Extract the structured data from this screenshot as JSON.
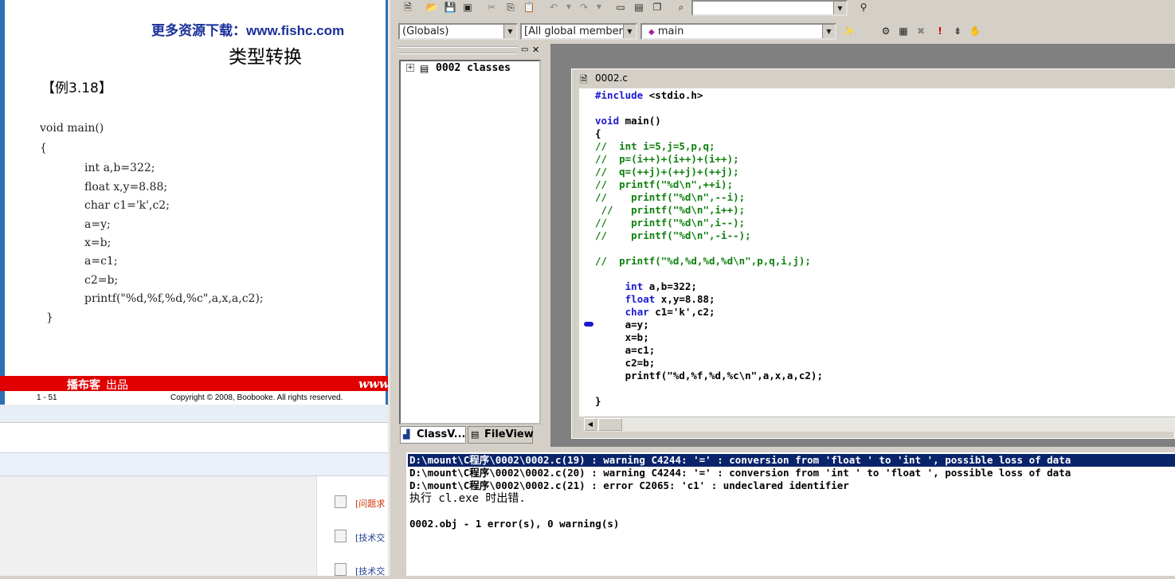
{
  "slide": {
    "url": "更多资源下载：www.fishc.com",
    "title": "类型转换",
    "example": "【例3.18】",
    "code": [
      "void main()",
      "{",
      "int a,b=322;",
      "float x,y=8.88;",
      "char c1='k',c2;",
      "a=y;",
      "x=b;",
      "a=c1;",
      "c2=b;",
      "printf(\"%d,%f,%d,%c\",a,x,a,c2);",
      "}"
    ],
    "brand": "播布客",
    "brand_sub": "出品",
    "www": "www",
    "page": "1 - 51",
    "copyright": "Copyright © 2008, Boobooke. All rights reserved."
  },
  "forum": {
    "items": [
      "[问题求",
      "[技术交",
      "[技术交"
    ]
  },
  "toolbar": {
    "globals": "(Globals)",
    "members": "[All global members",
    "function": "main"
  },
  "classview": {
    "root": "0002 classes",
    "tab_class": "ClassV...",
    "tab_file": "FileView"
  },
  "editor": {
    "filename": "0002.c",
    "lines": [
      {
        "t": "kw",
        "s": "#include",
        "r": " <stdio.h>"
      },
      {
        "t": "blank"
      },
      {
        "t": "kw",
        "s": "void",
        "r": " main()"
      },
      {
        "t": "tx",
        "s": "{"
      },
      {
        "t": "cm",
        "s": "//  int i=5,j=5,p,q;"
      },
      {
        "t": "cm",
        "s": "//  p=(i++)+(i++)+(i++);"
      },
      {
        "t": "cm",
        "s": "//  q=(++j)+(++j)+(++j);"
      },
      {
        "t": "cm",
        "s": "//  printf(\"%d\\n\",++i);"
      },
      {
        "t": "cm",
        "s": "//    printf(\"%d\\n\",--i);"
      },
      {
        "t": "cm",
        "s": " //   printf(\"%d\\n\",i++);"
      },
      {
        "t": "cm",
        "s": "//    printf(\"%d\\n\",i--);"
      },
      {
        "t": "cm",
        "s": "//    printf(\"%d\\n\",-i--);"
      },
      {
        "t": "blank"
      },
      {
        "t": "cm",
        "s": "//  printf(\"%d,%d,%d,%d\\n\",p,q,i,j);"
      },
      {
        "t": "blank"
      },
      {
        "t": "kw",
        "pre": "     ",
        "s": "int",
        "r": " a,b=322;"
      },
      {
        "t": "kw",
        "pre": "     ",
        "s": "float",
        "r": " x,y=8.88;"
      },
      {
        "t": "kw",
        "pre": "     ",
        "s": "char",
        "r": " c1='k',c2;"
      },
      {
        "t": "tx",
        "s": "     a=y;"
      },
      {
        "t": "tx",
        "s": "     x=b;"
      },
      {
        "t": "tx",
        "s": "     a=c1;"
      },
      {
        "t": "tx",
        "s": "     c2=b;"
      },
      {
        "t": "tx",
        "s": "     printf(\"%d,%f,%d,%c\\n\",a,x,a,c2);"
      },
      {
        "t": "blank"
      },
      {
        "t": "tx",
        "s": "}"
      }
    ]
  },
  "output": {
    "lines": [
      "D:\\mount\\C程序\\0002\\0002.c(19) : warning C4244: '=' : conversion from 'float ' to 'int ', possible loss of data",
      "D:\\mount\\C程序\\0002\\0002.c(20) : warning C4244: '=' : conversion from 'int ' to 'float ', possible loss of data",
      "D:\\mount\\C程序\\0002\\0002.c(21) : error C2065: 'c1' : undeclared identifier",
      "执行 cl.exe 时出错.",
      "",
      "0002.obj - 1 error(s), 0 warning(s)"
    ]
  },
  "colors": {
    "slide_blue": "#2c6fb4",
    "red_bar": "#e00000",
    "keyword": "#1a1ad0",
    "comment": "#108010",
    "selection": "#0a246a"
  }
}
